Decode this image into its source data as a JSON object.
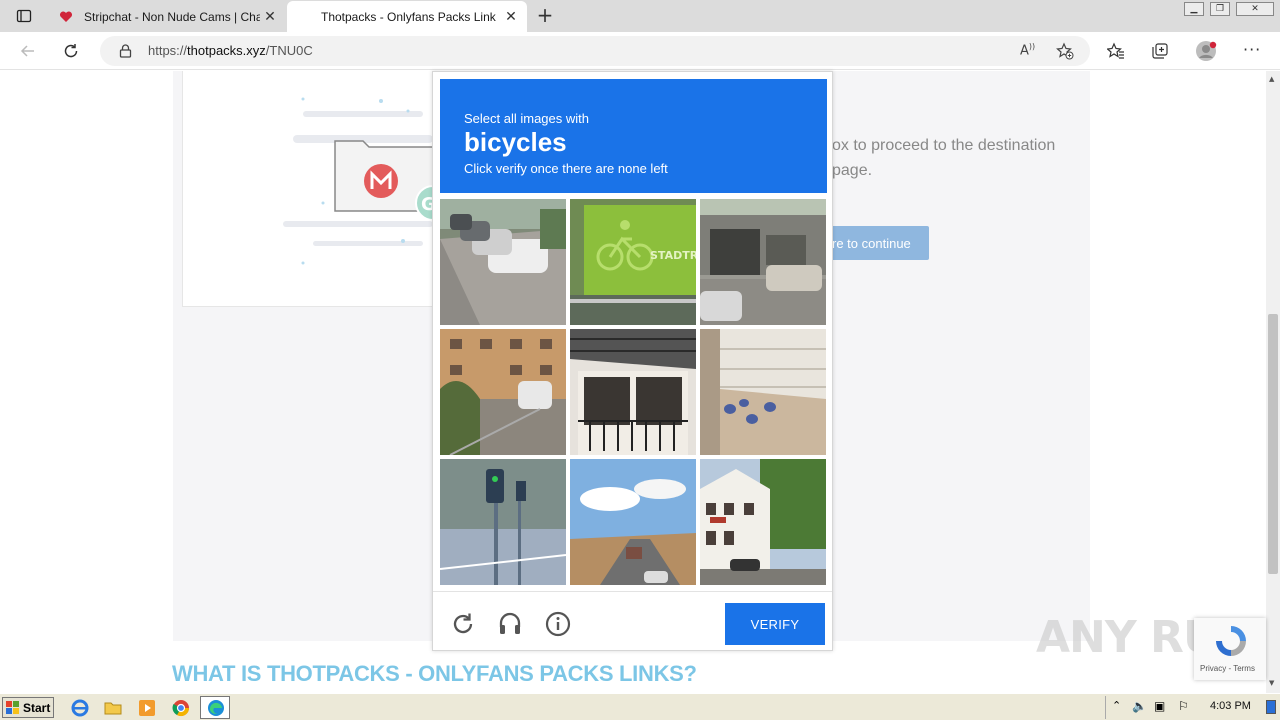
{
  "browser": {
    "tabs": [
      {
        "title": "Stripchat - Non Nude Cams | Cha",
        "active": false
      },
      {
        "title": "Thotpacks - Onlyfans Packs Link",
        "active": true
      }
    ],
    "url_prefix": "https://",
    "url_host": "thotpacks.xyz",
    "url_path": "/TNU0C"
  },
  "page": {
    "bg_text_line1": "ox to proceed to the destination",
    "bg_text_line2": "page.",
    "continue_btn": "re to continue",
    "headline": "WHAT IS THOTPACKS - ONLYFANS PACKS LINKS?"
  },
  "captcha": {
    "instruction": "Select all images with",
    "target": "bicycles",
    "hint": "Click verify once there are none left",
    "verify_label": "VERIFY",
    "tiles": [
      "street-cars",
      "bicycle-sign",
      "building-car",
      "apartment-car",
      "house-balcony",
      "stairs-shoes",
      "traffic-light",
      "highway-truck",
      "hotel-building"
    ],
    "header_color": "#1a73e8"
  },
  "recaptcha_badge": {
    "links": "Privacy - Terms"
  },
  "watermark": "ANY RUN",
  "taskbar": {
    "start_label": "Start",
    "clock": "4:03 PM"
  }
}
